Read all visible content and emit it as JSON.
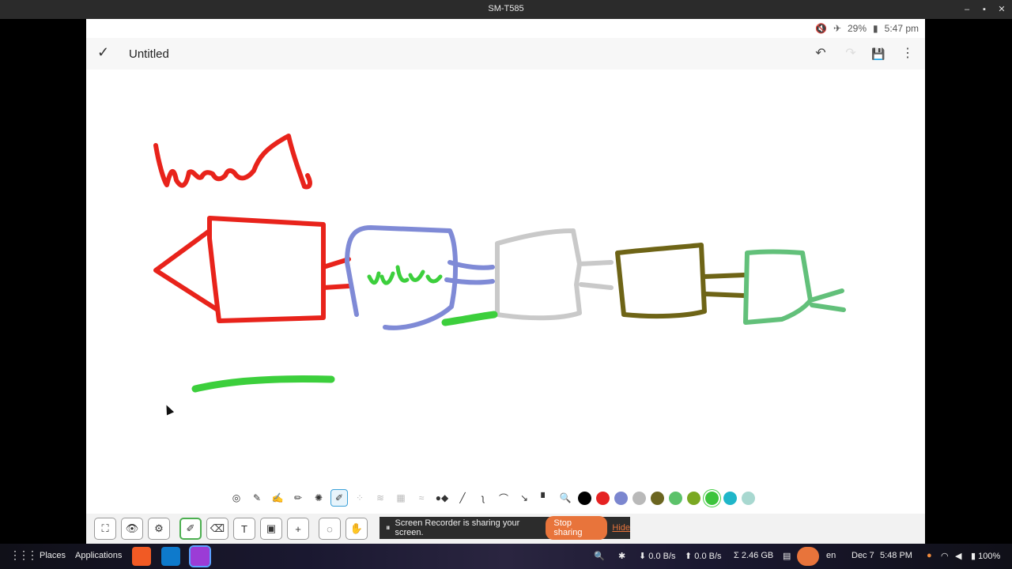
{
  "window": {
    "title": "SM-T585",
    "controls": [
      "–",
      "▪",
      "✕"
    ]
  },
  "status": {
    "mute": "🔇",
    "airplane": "✈",
    "battery": "29%",
    "battery_icon": "▮",
    "time": "5:47 pm"
  },
  "appbar": {
    "confirm_icon": "✓",
    "title": "Untitled",
    "undo_icon": "↶",
    "redo_icon": "↷",
    "save_icon": "💾",
    "more_icon": "⋮"
  },
  "pens": [
    {
      "name": "pen-style-ring",
      "glyph": "◎",
      "selected": false,
      "faint": false
    },
    {
      "name": "highlighter",
      "glyph": "✎",
      "selected": false,
      "faint": false
    },
    {
      "name": "brush",
      "glyph": "✍",
      "selected": false,
      "faint": false
    },
    {
      "name": "pencil",
      "glyph": "✏",
      "selected": false,
      "faint": false
    },
    {
      "name": "spray",
      "glyph": "✺",
      "selected": false,
      "faint": false
    },
    {
      "name": "marker",
      "glyph": "✐",
      "selected": true,
      "faint": false
    },
    {
      "name": "dots",
      "glyph": "⁘",
      "selected": false,
      "faint": true
    },
    {
      "name": "smudge",
      "glyph": "≋",
      "selected": false,
      "faint": true
    },
    {
      "name": "texture",
      "glyph": "▦",
      "selected": false,
      "faint": true
    },
    {
      "name": "blur",
      "glyph": "≈",
      "selected": false,
      "faint": true
    },
    {
      "name": "connector",
      "glyph": "●◆",
      "selected": false,
      "faint": false
    },
    {
      "name": "line",
      "glyph": "╱",
      "selected": false,
      "faint": false
    },
    {
      "name": "zigzag",
      "glyph": "ʅ",
      "selected": false,
      "faint": false
    },
    {
      "name": "arc",
      "glyph": "⌒",
      "selected": false,
      "faint": false
    },
    {
      "name": "arrow",
      "glyph": "↘",
      "selected": false,
      "faint": false
    },
    {
      "name": "point",
      "glyph": "▘",
      "selected": false,
      "faint": false
    },
    {
      "name": "magnifier",
      "glyph": "🔍",
      "selected": false,
      "faint": false
    }
  ],
  "colors": [
    {
      "hex": "#000000",
      "selected": false
    },
    {
      "hex": "#e52222",
      "selected": false
    },
    {
      "hex": "#7b86cf",
      "selected": false
    },
    {
      "hex": "#b9b9b9",
      "selected": false
    },
    {
      "hex": "#6b6520",
      "selected": false
    },
    {
      "hex": "#5cc26a",
      "selected": false
    },
    {
      "hex": "#7aa822",
      "selected": false
    },
    {
      "hex": "#3cc43c",
      "selected": true
    },
    {
      "hex": "#1fb6c9",
      "selected": false
    },
    {
      "hex": "#a8d8d0",
      "selected": false
    }
  ],
  "toolbar": [
    {
      "name": "fullscreen-button",
      "glyph": "⛶",
      "on": false
    },
    {
      "name": "view-button",
      "glyph": "👁",
      "on": false
    },
    {
      "name": "settings-button",
      "glyph": "⚙",
      "on": false
    },
    {
      "name": "pen-tool-button",
      "glyph": "✐",
      "on": true
    },
    {
      "name": "eraser-button",
      "glyph": "⌫",
      "on": false
    },
    {
      "name": "text-tool-button",
      "glyph": "T",
      "on": false
    },
    {
      "name": "image-tool-button",
      "glyph": "▣",
      "on": false
    },
    {
      "name": "add-button",
      "glyph": "+",
      "on": false
    },
    {
      "name": "lasso-button",
      "glyph": "◌",
      "on": false
    },
    {
      "name": "hand-button",
      "glyph": "✋",
      "on": false
    }
  ],
  "recorder": {
    "pause_icon": "⏸",
    "message": "Screen Recorder is sharing your screen.",
    "stop_label": "Stop sharing",
    "hide_label": "Hide"
  },
  "taskbar": {
    "grid_icon": "⋮⋮⋮",
    "places": "Places",
    "applications": "Applications",
    "search_icon": "🔍",
    "ext_icon": "✱",
    "down_speed": "0.0 B/s",
    "up_speed": "0.0 B/s",
    "mem": "2.46 GB",
    "lang": "en",
    "date": "Dec 7",
    "time": "5:48 PM",
    "battery": "100%"
  },
  "canvas_colors": {
    "red": "#e8231b",
    "blue": "#7f8ad6",
    "gray": "#c9c9c9",
    "olive": "#6e6416",
    "lightgreen": "#62c07a",
    "green": "#3ccf3c"
  }
}
